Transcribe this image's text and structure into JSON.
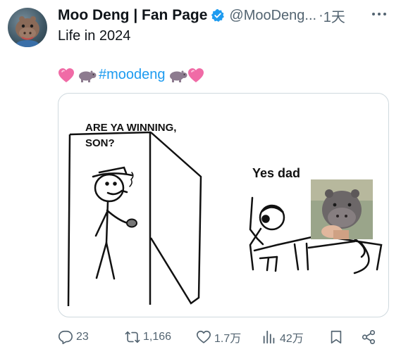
{
  "post": {
    "display_name": "Moo Deng | Fan Page",
    "handle": "@MooDeng...",
    "separator": "·",
    "time": "1天",
    "text_line1": "Life in 2024",
    "hashtag": "#moodeng"
  },
  "meme": {
    "dad_caption_line1": "ARE YA WINNING,",
    "dad_caption_line2": "SON?",
    "son_caption": "Yes dad"
  },
  "actions": {
    "replies": "23",
    "reposts": "1,166",
    "likes": "1.7万",
    "views": "42万"
  },
  "icons": {
    "verified": "verified-badge-icon",
    "more": "more-icon",
    "heart_emoji": "pink-heart-icon",
    "hippo_emoji": "hippo-icon",
    "reply": "reply-icon",
    "repost": "repost-icon",
    "like": "heart-icon",
    "views": "views-icon",
    "bookmark": "bookmark-icon",
    "share": "share-icon"
  },
  "colors": {
    "accent": "#1d9bf0",
    "secondary_text": "#536471",
    "border": "#cfd9de",
    "heart": "#f06ba6"
  }
}
